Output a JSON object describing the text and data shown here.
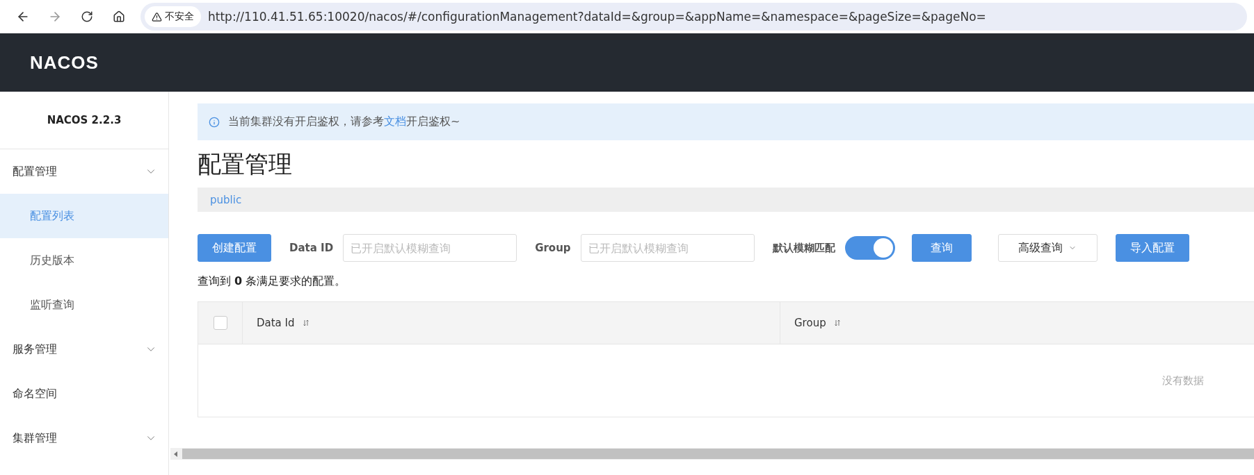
{
  "browser": {
    "security_label": "不安全",
    "url": "http://110.41.51.65:10020/nacos/#/configurationManagement?dataId=&group=&appName=&namespace=&pageSize=&pageNo="
  },
  "header": {
    "logo": "NACOS"
  },
  "sidebar": {
    "version": "NACOS 2.2.3",
    "items": [
      {
        "label": "配置管理",
        "kind": "group",
        "children": [
          {
            "label": "配置列表",
            "selected": true
          },
          {
            "label": "历史版本",
            "selected": false
          },
          {
            "label": "监听查询",
            "selected": false
          }
        ]
      },
      {
        "label": "服务管理",
        "kind": "group"
      },
      {
        "label": "命名空间",
        "kind": "link"
      },
      {
        "label": "集群管理",
        "kind": "group"
      }
    ]
  },
  "notice": {
    "text": "当前集群没有开启鉴权，请参考",
    "link": "文档",
    "text_after": "开启鉴权~"
  },
  "page_title": "配置管理",
  "namespace": "public",
  "toolbar": {
    "create_button": "创建配置",
    "data_id_label": "Data ID",
    "data_id_placeholder": "已开启默认模糊查询",
    "group_label": "Group",
    "group_placeholder": "已开启默认模糊查询",
    "fuzzy_label": "默认模糊匹配",
    "fuzzy_on": true,
    "query_button": "查询",
    "advanced_button": "高级查询",
    "import_button": "导入配置"
  },
  "result_summary": "查询到 **0** 条满足要求的配置。",
  "table": {
    "select_all_checked": false,
    "columns": [
      "Data Id",
      "Group"
    ],
    "empty_text": "没有数据"
  }
}
